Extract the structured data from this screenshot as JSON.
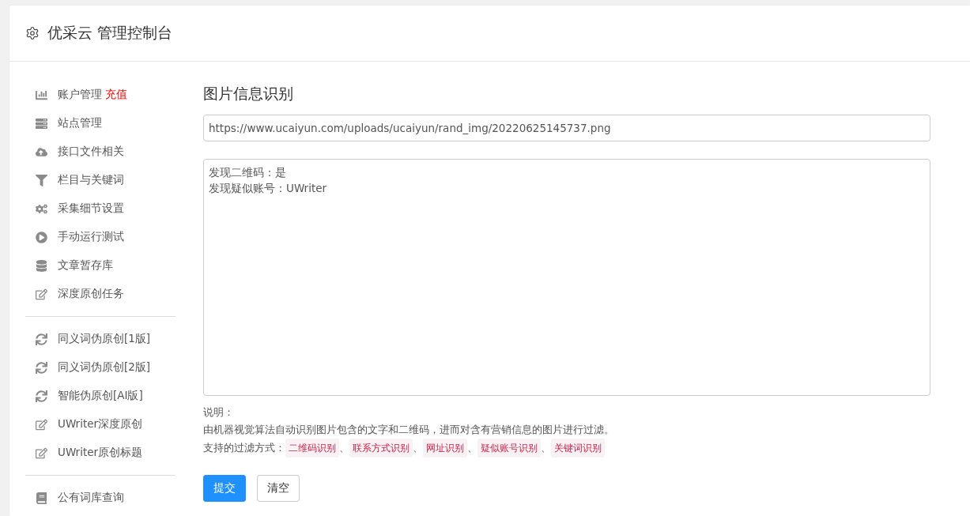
{
  "header": {
    "title": "优采云 管理控制台"
  },
  "sidebar": {
    "groups": [
      {
        "items": [
          {
            "label": "账户管理",
            "badge": "充值"
          },
          {
            "label": "站点管理"
          },
          {
            "label": "接口文件相关"
          },
          {
            "label": "栏目与关键词"
          },
          {
            "label": "采集细节设置"
          },
          {
            "label": "手动运行测试"
          },
          {
            "label": "文章暂存库"
          },
          {
            "label": "深度原创任务"
          }
        ]
      },
      {
        "items": [
          {
            "label": "同义词伪原创[1版]"
          },
          {
            "label": "同义词伪原创[2版]"
          },
          {
            "label": "智能伪原创[AI版]"
          },
          {
            "label": "UWriter深度原创"
          },
          {
            "label": "UWriter原创标题"
          }
        ]
      },
      {
        "items": [
          {
            "label": "公有词库查询"
          }
        ]
      }
    ]
  },
  "main": {
    "title": "图片信息识别",
    "url_field": {
      "value": "https://www.ucaiyun.com/uploads/ucaiyun/rand_img/20220625145737.png"
    },
    "result_box": {
      "lines": [
        "发现二维码：是",
        "发现疑似账号：UWriter"
      ]
    },
    "note_heading": "说明：",
    "note_text": "由机器视觉算法自动识别图片包含的文字和二维码，进而对含有营销信息的图片进行过滤。",
    "methods_label": "支持的过滤方式：",
    "methods": [
      "二维码识别",
      "联系方式识别",
      "网址识别",
      "疑似账号识别",
      "关键词识别"
    ],
    "separator": "、",
    "buttons": [
      {
        "label": "提交",
        "kind": "primary"
      },
      {
        "label": "清空",
        "kind": "default"
      }
    ]
  }
}
